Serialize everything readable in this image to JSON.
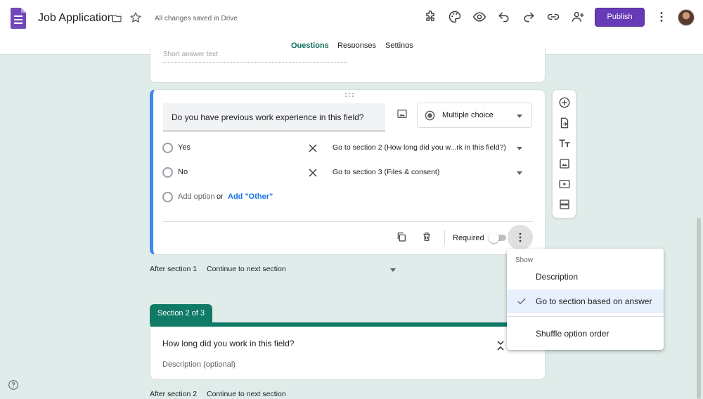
{
  "header": {
    "title": "Job Application",
    "save_status": "All changes saved in Drive",
    "publish_label": "Publish",
    "icons": [
      "addon-icon",
      "palette-icon",
      "preview-icon",
      "undo-icon",
      "redo-icon",
      "link-icon",
      "add-collaborator-icon",
      "more-vert-icon"
    ]
  },
  "tabs": [
    {
      "label": "Questions",
      "active": true
    },
    {
      "label": "Responses",
      "active": false
    },
    {
      "label": "Settings",
      "active": false
    }
  ],
  "prev_card": {
    "placeholder": "Short answer text"
  },
  "question": {
    "title": "Do you have previous work experience in this field?",
    "type": "Multiple choice",
    "options": [
      {
        "label": "Yes",
        "goto": "Go to section 2 (How long did you w...rk in this field?)"
      },
      {
        "label": "No",
        "goto": "Go to section 3 (Files & consent)"
      }
    ],
    "add_option": "Add option",
    "or": "or",
    "add_other": "Add \"Other\"",
    "required_label": "Required"
  },
  "after_section_1": {
    "label": "After section 1",
    "value": "Continue to next section"
  },
  "section2": {
    "badge": "Section 2 of 3",
    "title": "How long did you work in this field?",
    "description": "Description (optional)"
  },
  "after_section_2": {
    "label": "After section 2",
    "value": "Continue to next section"
  },
  "side_toolbar": [
    "add-question-icon",
    "import-questions-icon",
    "add-title-icon",
    "add-image-icon",
    "add-video-icon",
    "add-section-icon"
  ],
  "menu": {
    "header": "Show",
    "items": [
      {
        "label": "Description",
        "checked": false
      },
      {
        "label": "Go to section based on answer",
        "checked": true
      },
      {
        "label": "Shuffle option order",
        "checked": false
      }
    ]
  },
  "colors": {
    "accent": "#673ab7",
    "section": "#0f7a65",
    "question_edge": "#4285f4"
  }
}
